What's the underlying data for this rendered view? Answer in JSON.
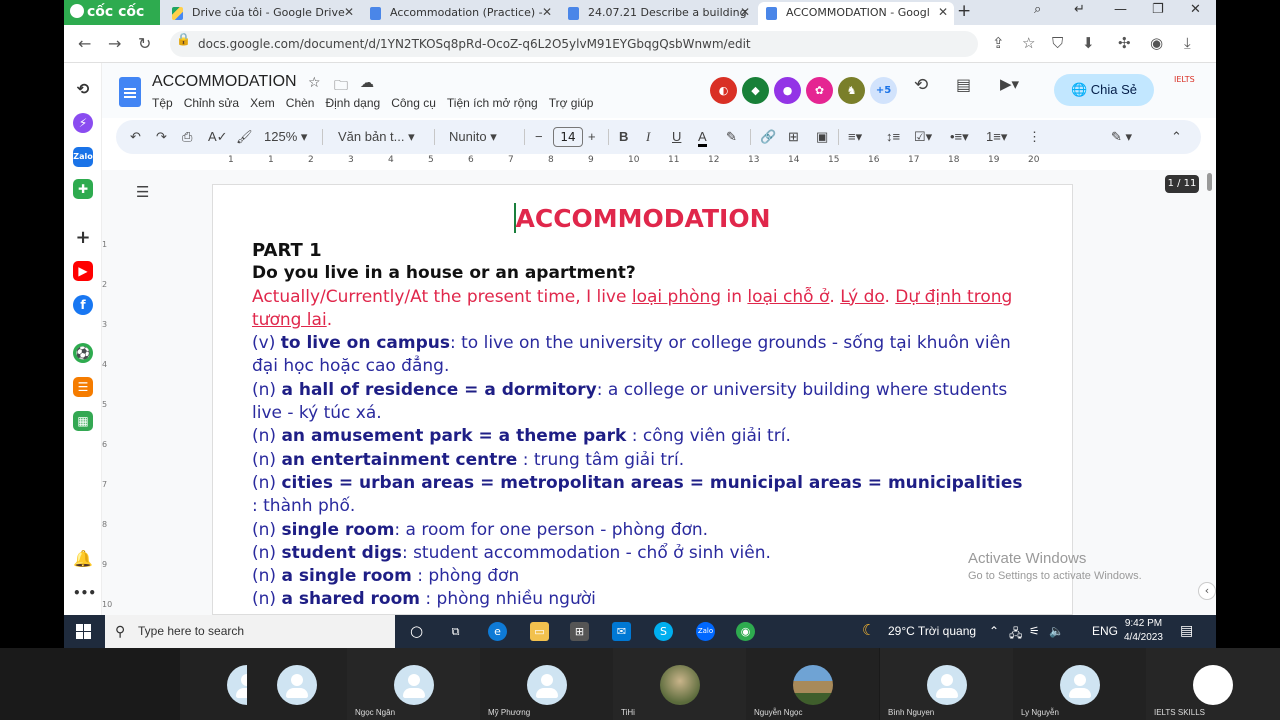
{
  "browser": {
    "brand": "cốc cốc",
    "tabs": [
      {
        "label": "Drive của tôi - Google Drive",
        "icon": "google-drive-icon"
      },
      {
        "label": "Accommodation (Practice) -",
        "icon": "google-docs-icon"
      },
      {
        "label": "24.07.21 Describe a building",
        "icon": "google-docs-icon"
      },
      {
        "label": "ACCOMMODATION - Googl",
        "icon": "google-docs-icon",
        "active": true
      }
    ],
    "url": "docs.google.com/document/d/1YN2TKOSq8pRd-OcoZ-q6L2O5ylvM91EYGbqgQsbWnwm/edit"
  },
  "docs": {
    "title": "ACCOMMODATION",
    "menu": [
      "Tệp",
      "Chỉnh sửa",
      "Xem",
      "Chèn",
      "Định dạng",
      "Công cụ",
      "Tiện ích mở rộng",
      "Trợ giúp"
    ],
    "extra_collaborators": "+5",
    "share_label": "Chia Sẻ",
    "toolbar": {
      "zoom": "125%",
      "style": "Văn bản t...",
      "font": "Nunito",
      "font_size": "14"
    },
    "ruler_marks": [
      "1",
      "1",
      "2",
      "3",
      "4",
      "5",
      "6",
      "7",
      "8",
      "9",
      "10",
      "11",
      "12",
      "13",
      "14",
      "15",
      "16",
      "17",
      "18",
      "19",
      "20"
    ],
    "vruler_marks": [
      "1",
      "2",
      "3",
      "4",
      "5",
      "6",
      "7",
      "8",
      "9",
      "10"
    ],
    "page_count": "1 / 11"
  },
  "document": {
    "heading": "ACCOMMODATION",
    "part": "PART 1",
    "question": "Do you live in a house or an apartment?",
    "template": {
      "prefix": "Actually/Currently/At the present time, I live ",
      "u1": "loại phòng",
      "mid1": " in ",
      "u2": "loại chỗ ở",
      "mid2": ". ",
      "u3": "Lý do",
      "mid3": ". ",
      "u4": "Dự định trong tương lai",
      "end": "."
    },
    "vocab": [
      {
        "pos": "(v) ",
        "term": "to live on campus",
        "def": ": to live on the university or college grounds - sống tại khuôn viên đại học hoặc cao đẳng."
      },
      {
        "pos": "(n) ",
        "term": "a hall of residence = a dormitory",
        "def": ": a college or university building where students live - ký túc xá."
      },
      {
        "pos": "(n) ",
        "term": "an amusement park = a theme park",
        "def": " : công viên giải trí."
      },
      {
        "pos": "(n) ",
        "term": "an entertainment centre",
        "def": " : trung tâm giải trí."
      },
      {
        "pos": "(n) ",
        "term": "cities = urban areas = metropolitan areas = municipal areas = municipalities",
        "def": " : thành phố."
      },
      {
        "pos": "(n) ",
        "term": "single room",
        "def": ": a room for one person - phòng đơn."
      },
      {
        "pos": "(n) ",
        "term": "student digs",
        "def": ": student accommodation - chổ ở sinh viên."
      },
      {
        "pos": "(n) ",
        "term": "a single room",
        "def": " : phòng đơn"
      },
      {
        "pos": "(n) ",
        "term": "a shared room",
        "def": " : phòng nhiều người"
      }
    ]
  },
  "activate_windows": {
    "title": "Activate Windows",
    "subtitle": "Go to Settings to activate Windows."
  },
  "taskbar": {
    "search_placeholder": "Type here to search",
    "weather": "29°C  Trời quang",
    "language": "ENG",
    "time": "9:42 PM",
    "date": "4/4/2023"
  },
  "participants": [
    {
      "name": "",
      "type": "avatar"
    },
    {
      "name": "",
      "type": "avatar"
    },
    {
      "name": "Ngọc Ngân",
      "type": "avatar"
    },
    {
      "name": "Mỹ Phương",
      "type": "avatar"
    },
    {
      "name": "TiHi",
      "type": "photo"
    },
    {
      "name": "Nguyễn Ngọc",
      "type": "photo"
    },
    {
      "name": "Bình Nguyen",
      "type": "avatar"
    },
    {
      "name": "Ly Nguyễn",
      "type": "avatar"
    },
    {
      "name": "IELTS SKILLS",
      "type": "logo"
    }
  ]
}
